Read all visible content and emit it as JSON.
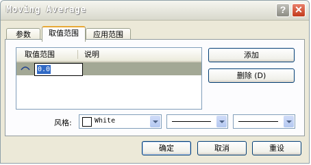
{
  "window": {
    "title": "Moving Average",
    "help_label": "?",
    "close_label": "✕"
  },
  "tabs": [
    {
      "label": "参数",
      "active": false
    },
    {
      "label": "取值范围",
      "active": true
    },
    {
      "label": "应用范围",
      "active": false
    }
  ],
  "levels_list": {
    "columns": [
      "取值范围",
      "说明"
    ],
    "rows": [
      {
        "value": "0.0",
        "description": "",
        "icon": "level-line-icon"
      }
    ]
  },
  "side_buttons": {
    "add": "添加",
    "delete": "删除 (D)"
  },
  "style_row": {
    "label": "风格:",
    "color_name": "White",
    "color_hex": "#ffffff",
    "line_style": "solid",
    "line_width": "thin"
  },
  "footer": {
    "ok": "确定",
    "cancel": "取消",
    "reset": "重设"
  },
  "colors": {
    "selected_row": "#a3a895",
    "dialog_bg": "#ece9d8",
    "tab_highlight": "#e8a834"
  }
}
